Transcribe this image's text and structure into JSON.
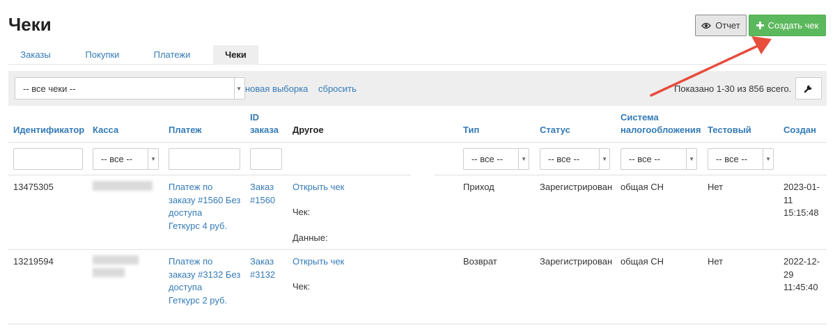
{
  "page": {
    "title": "Чеки"
  },
  "actions": {
    "report_label": "Отчет",
    "create_label": "Создать чек"
  },
  "tabs": [
    {
      "label": "Заказы",
      "active": false
    },
    {
      "label": "Покупки",
      "active": false
    },
    {
      "label": "Платежи",
      "active": false
    },
    {
      "label": "Чеки",
      "active": true
    }
  ],
  "filterbar": {
    "select_value": "-- все чеки --",
    "new_selection": "новая выборка",
    "reset": "сбросить",
    "shown": "Показано 1-30 из 856 всего."
  },
  "columns": {
    "id": "Идентификатор",
    "kassa": "Касса",
    "payment": "Платеж",
    "order_id_1": "ID",
    "order_id_2": "заказа",
    "other": "Другое",
    "type": "Тип",
    "status": "Статус",
    "tax_1": "Система",
    "tax_2": "налогообложения",
    "test": "Тестовый",
    "created": "Создан"
  },
  "filters": {
    "all": "-- все --"
  },
  "rows": [
    {
      "id": "13475305",
      "payment_1": "Платеж по",
      "payment_2": "заказу #1560 Без",
      "payment_3": "доступа",
      "payment_4": "Геткурс 4 руб.",
      "order_1": "Заказ",
      "order_2": "#1560",
      "open_receipt": "Открыть чек",
      "receipt_label": "Чек:",
      "data_label": "Данные:",
      "type": "Приход",
      "status": "Зарегистрирован",
      "tax": "общая СН",
      "test": "Нет",
      "created_1": "2023-01-",
      "created_2": "11",
      "created_3": "15:15:48"
    },
    {
      "id": "13219594",
      "payment_1": "Платеж по",
      "payment_2": "заказу #3132 Без",
      "payment_3": "доступа",
      "payment_4": "Геткурс 2 руб.",
      "order_1": "Заказ",
      "order_2": "#3132",
      "open_receipt": "Открыть чек",
      "receipt_label": "Чек:",
      "type": "Возврат",
      "status": "Зарегистрирован",
      "tax": "общая СН",
      "test": "Нет",
      "created_1": "2022-12-",
      "created_2": "29",
      "created_3": "11:45:40"
    }
  ],
  "icons": {
    "report": "eye-icon",
    "create": "plus-icon",
    "settings": "wrench-icon",
    "annotation": "red-arrow"
  },
  "colors": {
    "link": "#337ab7",
    "create_button": "#5cb85c",
    "arrow": "#e74c3c"
  }
}
